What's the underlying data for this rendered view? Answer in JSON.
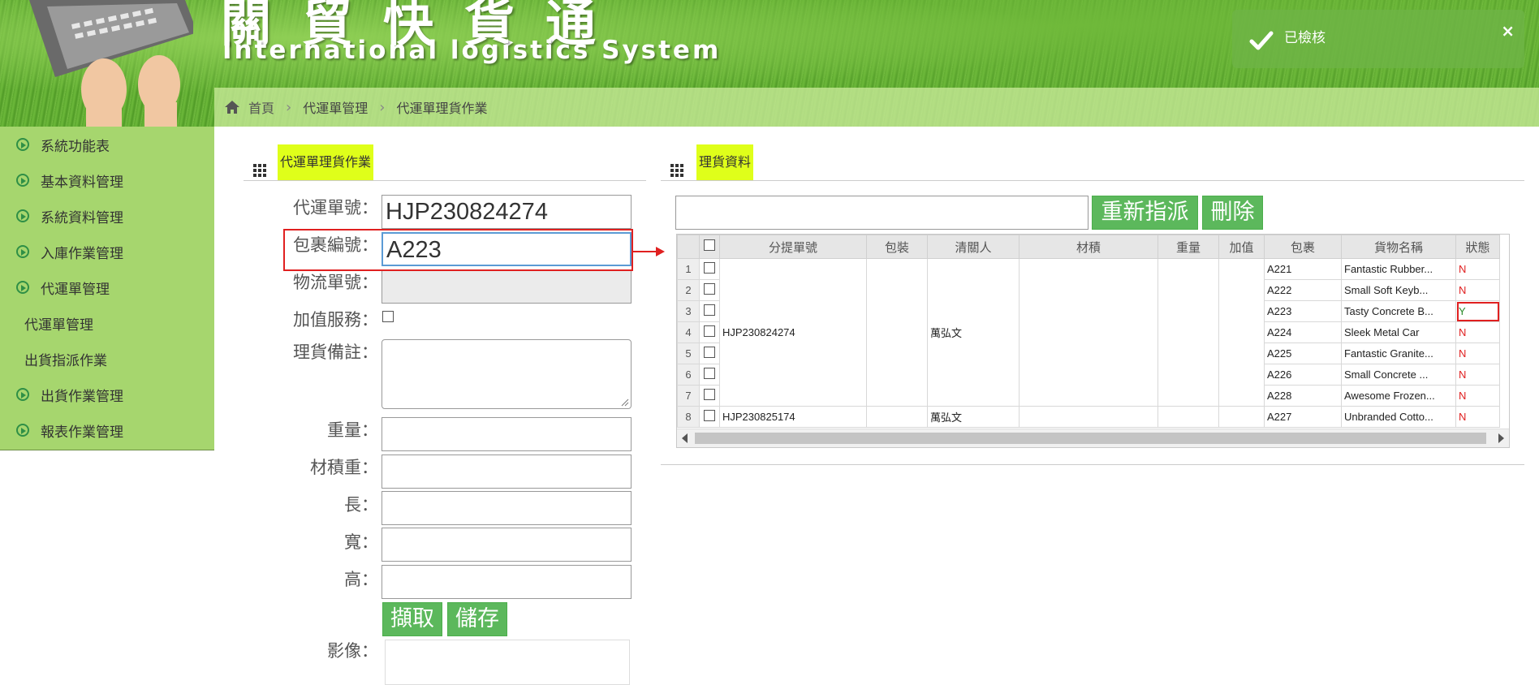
{
  "header": {
    "title_cn": "關貿快貨通",
    "title_en": "International logistics System"
  },
  "breadcrumb": [
    "首頁",
    "代運單管理",
    "代運單理貨作業"
  ],
  "toast": {
    "message": "已檢核",
    "close": "×"
  },
  "sidebar": {
    "items": [
      {
        "label": "系統功能表",
        "icon": "circle-arrow-icon"
      },
      {
        "label": "基本資料管理",
        "icon": "circle-arrow-icon"
      },
      {
        "label": "系統資料管理",
        "icon": "circle-arrow-icon"
      },
      {
        "label": "入庫作業管理",
        "icon": "circle-arrow-icon"
      },
      {
        "label": "代運單管理",
        "icon": "circle-arrow-icon"
      },
      {
        "label": "代運單管理",
        "icon": ""
      },
      {
        "label": "出貨指派作業",
        "icon": ""
      },
      {
        "label": "出貨作業管理",
        "icon": "circle-arrow-icon"
      },
      {
        "label": "報表作業管理",
        "icon": "circle-arrow-icon"
      }
    ]
  },
  "left_panel": {
    "title": "代運單理貨作業",
    "fields": {
      "waybill_label": "代運單號：",
      "waybill_value": "HJP230824274",
      "package_label": "包裹編號：",
      "package_value": "A223",
      "logistics_label": "物流單號：",
      "value_added_label": "加值服務：",
      "remark_label": "理貨備註：",
      "weight_label": "重量：",
      "volume_weight_label": "材積重：",
      "length_label": "長：",
      "width_label": "寬：",
      "height_label": "高：",
      "image_label": "影像："
    },
    "buttons": {
      "capture": "擷取",
      "save": "儲存"
    }
  },
  "right_panel": {
    "title": "理貨資料",
    "buttons": {
      "reassign": "重新指派",
      "delete": "刪除"
    },
    "columns": [
      "分提單號",
      "包裝",
      "清關人",
      "材積",
      "重量",
      "加值",
      "包裹",
      "貨物名稱",
      "狀態"
    ],
    "rows": [
      {
        "num": "1",
        "package": "A221",
        "goods": "Fantastic Rubber...",
        "status": "N"
      },
      {
        "num": "2",
        "package": "A222",
        "goods": "Small Soft Keyb...",
        "status": "N"
      },
      {
        "num": "3",
        "package": "A223",
        "goods": "Tasty Concrete B...",
        "status": "Y"
      },
      {
        "num": "4",
        "package": "A224",
        "goods": "Sleek Metal Car",
        "status": "N"
      },
      {
        "num": "5",
        "package": "A225",
        "goods": "Fantastic Granite...",
        "status": "N"
      },
      {
        "num": "6",
        "package": "A226",
        "goods": "Small Concrete ...",
        "status": "N"
      },
      {
        "num": "7",
        "package": "A228",
        "goods": "Awesome Frozen...",
        "status": "N"
      },
      {
        "num": "8",
        "package": "A227",
        "goods": "Unbranded Cotto...",
        "status": "N"
      }
    ],
    "group1": {
      "bill": "HJP230824274",
      "clearer": "萬弘文"
    },
    "group2": {
      "bill": "HJP230825174",
      "clearer": "萬弘文"
    }
  },
  "colors": {
    "sidebar_bg": "#a6d66e",
    "button_green": "#5cb85c",
    "title_highlight": "#dfff1a",
    "status_n": "#e02020",
    "status_y": "#2a8a2a",
    "annotation_red": "#e02020"
  }
}
